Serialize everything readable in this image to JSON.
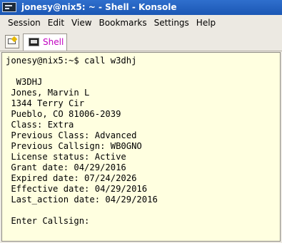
{
  "window": {
    "title": "jonesy@nix5: ~ - Shell - Konsole"
  },
  "menubar": {
    "items": [
      "Session",
      "Edit",
      "View",
      "Bookmarks",
      "Settings",
      "Help"
    ]
  },
  "tabs": [
    {
      "label": "Shell",
      "color": "#c000c0"
    }
  ],
  "terminal": {
    "background": "#ffffe0",
    "lines": [
      "jonesy@nix5:~$ call w3dhj",
      "",
      "  W3DHJ",
      " Jones, Marvin L",
      " 1344 Terry Cir",
      " Pueblo, CO 81006-2039",
      " Class: Extra",
      " Previous Class: Advanced",
      " Previous Callsign: WB0GNO",
      " License status: Active",
      " Grant date: 04/29/2016",
      " Expired date: 07/24/2026",
      " Effective date: 04/29/2016",
      " Last_action date: 04/29/2016",
      "",
      " Enter Callsign:"
    ]
  }
}
